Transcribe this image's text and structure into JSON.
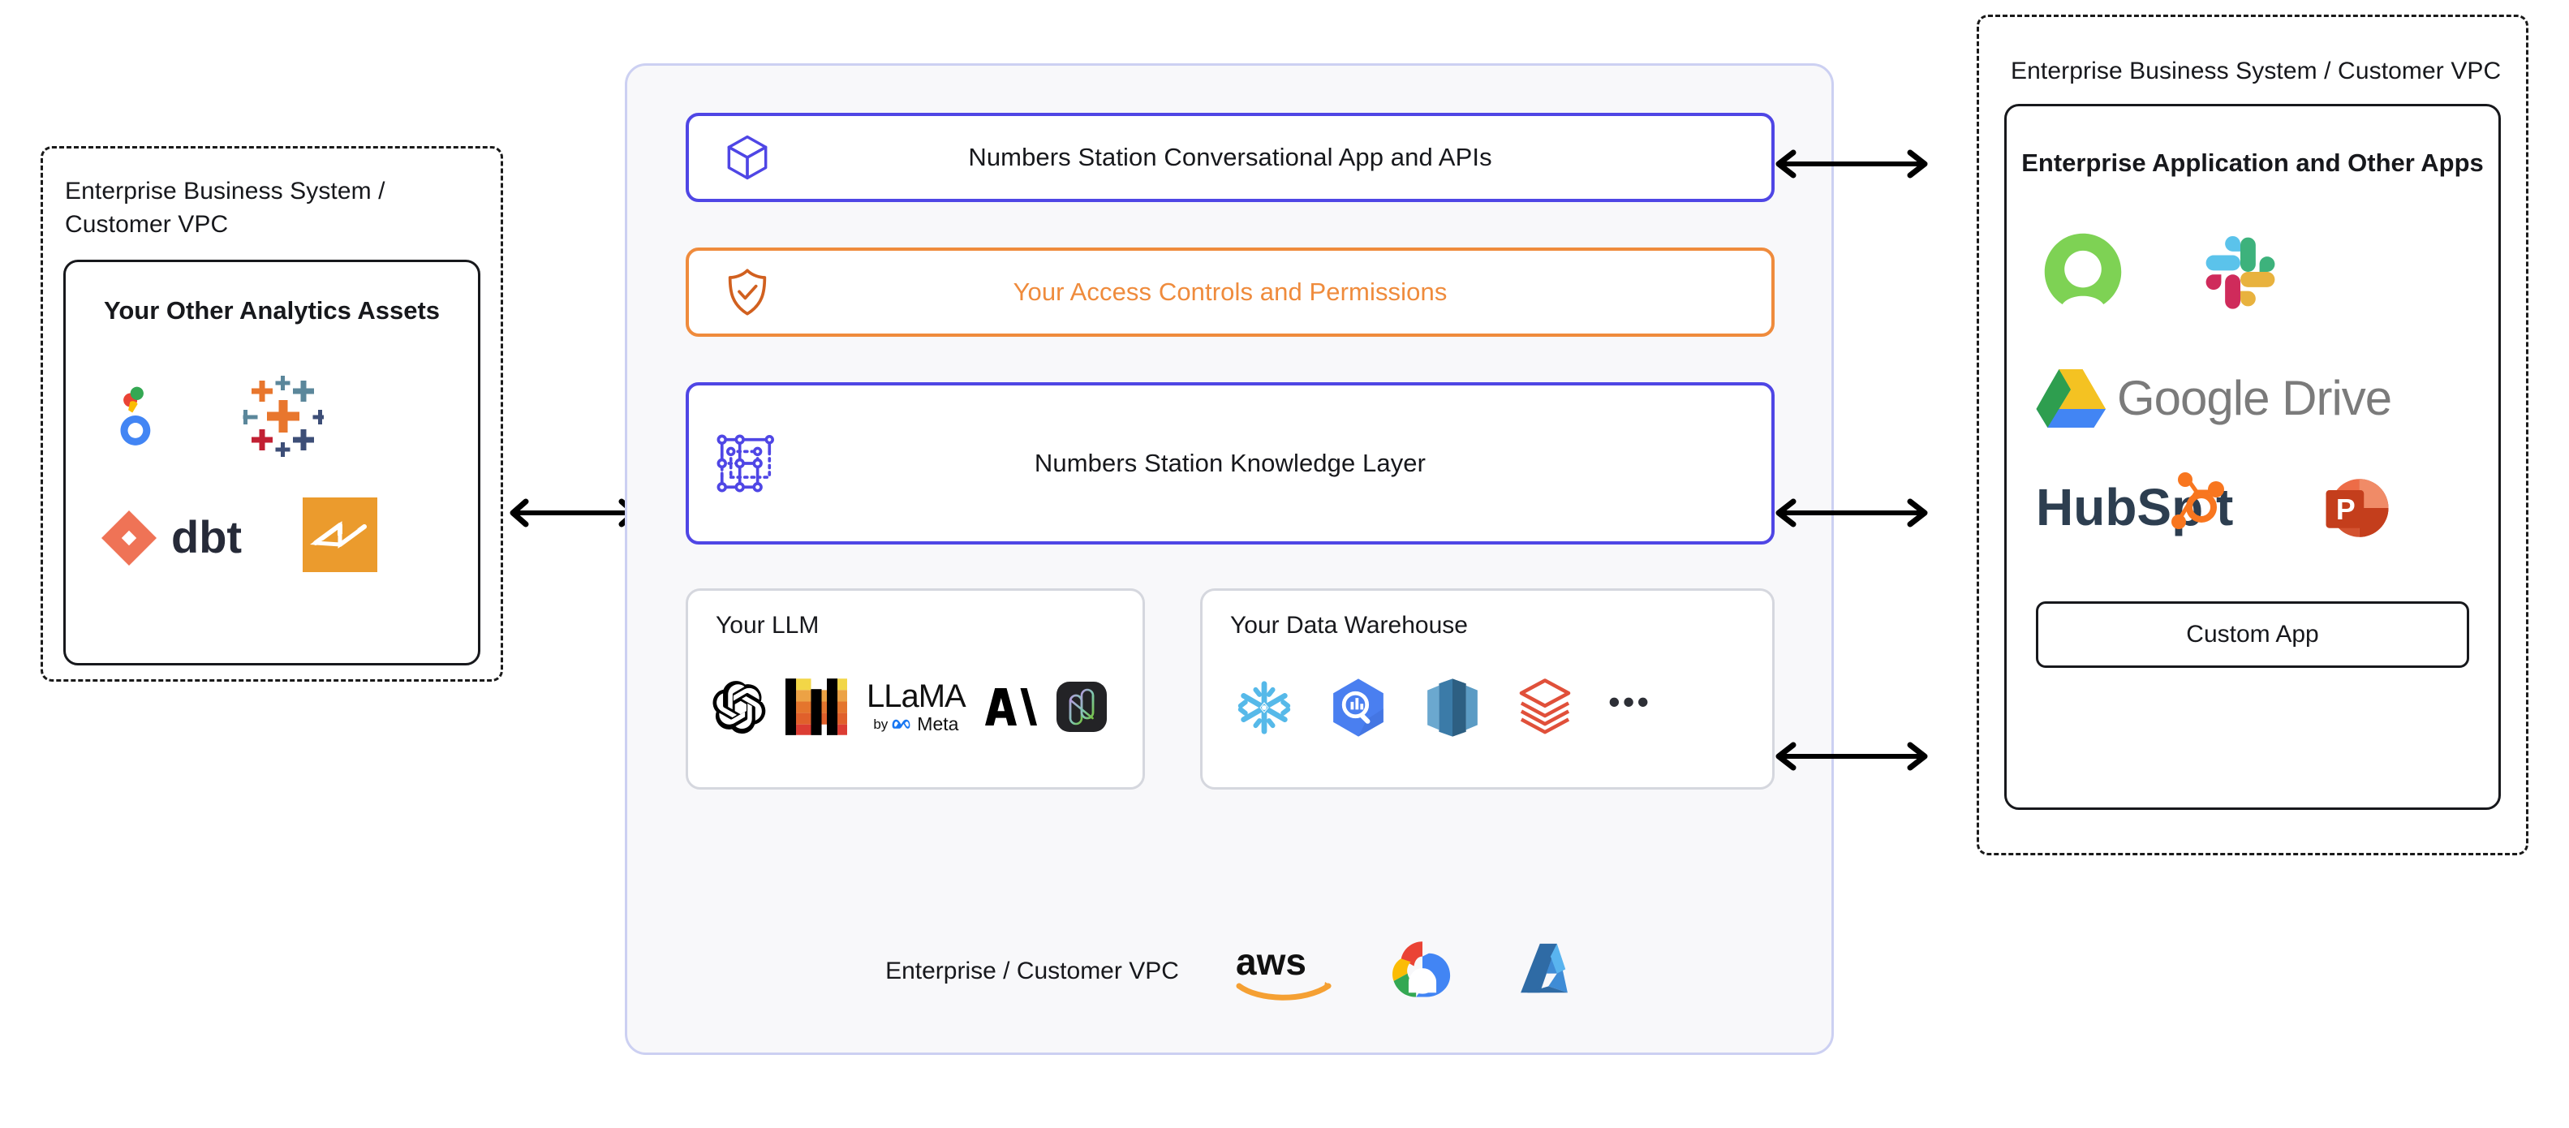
{
  "left_vpc": {
    "title": "Enterprise Business System /\nCustomer VPC",
    "title_line1": "Enterprise Business System /",
    "title_line2": "Customer VPC",
    "card": {
      "title": "Your Other Analytics Assets",
      "logos": [
        {
          "name": "looker-logo",
          "label": "Looker"
        },
        {
          "name": "tableau-logo",
          "label": "Tableau"
        },
        {
          "name": "dbt-logo",
          "label": "dbt"
        },
        {
          "name": "sigma-logo",
          "label": "Sigma"
        }
      ]
    }
  },
  "center": {
    "boxes": [
      {
        "id": "conversational-app",
        "label": "Numbers Station Conversational App and APIs",
        "icon": "cube-icon",
        "accent": "#4f46e5"
      },
      {
        "id": "access-controls",
        "label": "Your Access Controls and Permissions",
        "icon": "shield-check-icon",
        "accent": "#ef8b3c"
      },
      {
        "id": "knowledge-layer",
        "label": "Numbers Station Knowledge Layer",
        "icon": "knowledge-graph-icon",
        "accent": "#4f46e5"
      }
    ],
    "llm_card": {
      "title": "Your LLM",
      "logos": [
        {
          "name": "openai-logo",
          "label": "OpenAI"
        },
        {
          "name": "mistral-logo",
          "label": "Mistral AI"
        },
        {
          "name": "llama-meta-logo",
          "label": "LLaMA by Meta",
          "text_top": "LLaMA",
          "text_bottom_prefix": "by",
          "text_bottom": "Meta"
        },
        {
          "name": "anthropic-logo",
          "label": "Anthropic"
        },
        {
          "name": "nvidia-nemo-logo",
          "label": "NVIDIA NeMo"
        }
      ]
    },
    "warehouse_card": {
      "title": "Your Data Warehouse",
      "logos": [
        {
          "name": "snowflake-logo",
          "label": "Snowflake"
        },
        {
          "name": "bigquery-logo",
          "label": "Google BigQuery"
        },
        {
          "name": "redshift-logo",
          "label": "Amazon Redshift"
        },
        {
          "name": "databricks-logo",
          "label": "Databricks"
        }
      ],
      "more": "•••"
    },
    "footer": {
      "label": "Enterprise / Customer VPC",
      "logos": [
        {
          "name": "aws-logo",
          "label": "aws",
          "text": "aws"
        },
        {
          "name": "google-cloud-logo",
          "label": "Google Cloud"
        },
        {
          "name": "microsoft-azure-logo",
          "label": "Microsoft Azure"
        }
      ]
    }
  },
  "right_vpc": {
    "title": "Enterprise Business System / Customer VPC",
    "card": {
      "title": "Enterprise Application and Other Apps",
      "logos": [
        {
          "name": "quip-logo",
          "label": "Quip"
        },
        {
          "name": "slack-logo",
          "label": "Slack"
        },
        {
          "name": "google-drive-logo",
          "label": "Google Drive",
          "text": "Google Drive"
        },
        {
          "name": "hubspot-logo",
          "label": "HubSpot",
          "text_a": "HubSp",
          "text_b": "t"
        },
        {
          "name": "powerpoint-logo",
          "label": "Microsoft PowerPoint",
          "glyph": "P"
        }
      ],
      "custom_app_button": "Custom App"
    }
  },
  "arrows": [
    {
      "name": "arrow-left-to-center",
      "direction": "bidirectional"
    },
    {
      "name": "arrow-center-to-right-top",
      "direction": "bidirectional"
    },
    {
      "name": "arrow-center-to-right-middle",
      "direction": "bidirectional"
    },
    {
      "name": "arrow-center-to-right-bottom",
      "direction": "bidirectional"
    }
  ],
  "colors": {
    "purple": "#4f46e5",
    "orange": "#ef8b3c",
    "panel_bg": "#f8f8fa",
    "panel_border": "#ccd0f2",
    "dark": "#17181c"
  }
}
